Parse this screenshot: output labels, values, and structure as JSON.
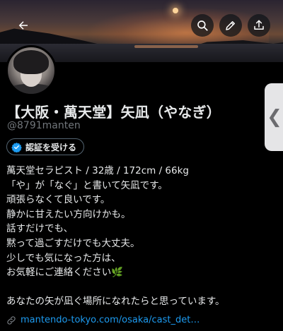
{
  "header": {
    "back_icon": "arrow-left-icon",
    "search_icon": "search-icon",
    "edit_icon": "pencil-icon",
    "share_icon": "share-icon"
  },
  "profile": {
    "display_name": "【大阪・萬天堂】矢凪（やなぎ）",
    "handle": "@8791manten",
    "verify_button_label": "認証を受ける",
    "verify_icon": "verified-badge-icon"
  },
  "bio": {
    "lines": [
      "萬天堂セラピスト / 32歳 / 172cm / 66kg",
      "「や」が「なぐ」と書いて矢凪です。",
      "頑張らなくて良いです。",
      "静かに甘えたい方向けかも。",
      "話すだけでも、",
      "黙って過ごすだけでも大丈夫。",
      "少しでも気になった方は、",
      "お気軽にご連絡ください",
      "",
      "あなたの矢が凪ぐ場所になれたらと思っています。"
    ],
    "emoji": "🌿"
  },
  "link": {
    "icon": "link-icon",
    "text": "mantendo-tokyo.com/osaka/cast_det…"
  },
  "side_tab": {
    "glyph": "❮"
  },
  "colors": {
    "background": "#000000",
    "text": "#e7e9ea",
    "secondary_text": "#71767b",
    "link": "#1d9bf0",
    "verified": "#1d9bf0"
  }
}
